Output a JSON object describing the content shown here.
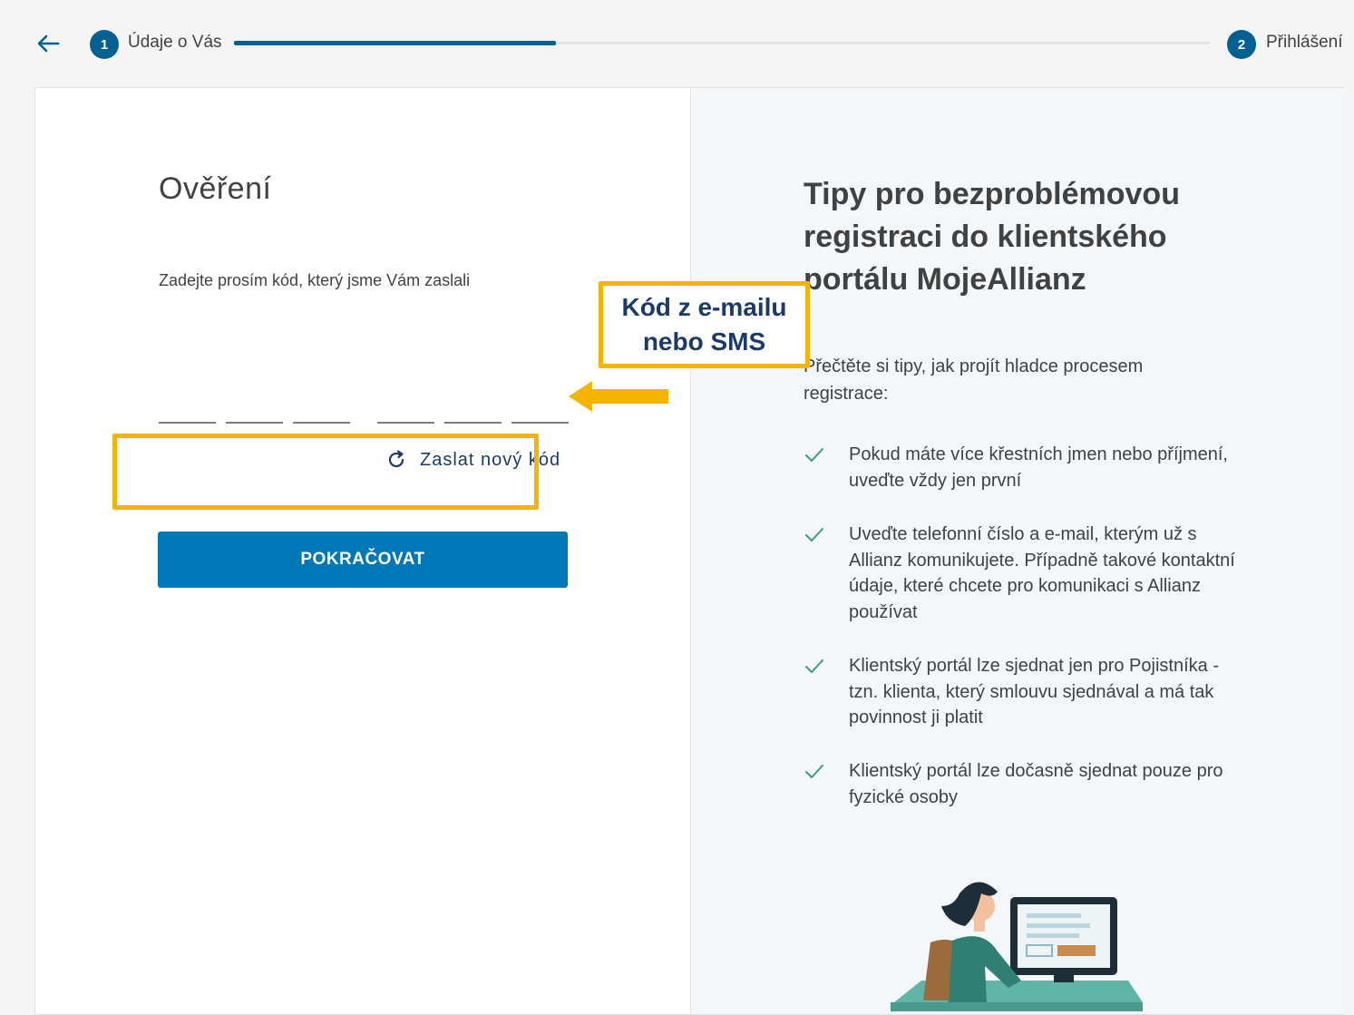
{
  "progress": {
    "back_icon": "arrow-left-icon",
    "step1": {
      "number": "1",
      "label": "Údaje o Vás"
    },
    "step2": {
      "number": "2",
      "label": "Přihlášení"
    },
    "progress_fraction": 0.33,
    "accent_color": "#006192"
  },
  "form": {
    "title": "Ověření",
    "instruction": "Zadejte prosím kód, který jsme Vám zaslali",
    "code_fields": [
      "",
      "",
      "",
      "",
      "",
      ""
    ],
    "resend_icon": "refresh-icon",
    "resend_label": "Zaslat nový kód",
    "submit_label": "POKRAČOVAT",
    "button_color": "#0077b6"
  },
  "callout": {
    "line1": "Kód z e-mailu",
    "line2": "nebo SMS",
    "border_color": "#f5b400"
  },
  "tips": {
    "title_line1": "Tipy pro bezproblémovou",
    "title_line2": "registraci do klientského",
    "title_line3": "portálu MojeAllianz",
    "intro": "Přečtěte si tipy, jak projít hladce procesem registrace:",
    "check_icon": "check-icon",
    "items": [
      "Pokud máte více křestních jmen nebo příjmení, uveďte vždy jen první",
      "Uveďte telefonní číslo a e-mail, kterým už s Allianz komunikujete. Případně takové kontaktní údaje, které chcete pro komunikaci s Allianz používat",
      "Klientský portál lze sjednat jen pro Pojistníka - tzn. klienta, který smlouvu sjednával a má tak povinnost ji platit",
      "Klientský portál lze dočasně sjednat pouze pro fyzické osoby"
    ]
  }
}
